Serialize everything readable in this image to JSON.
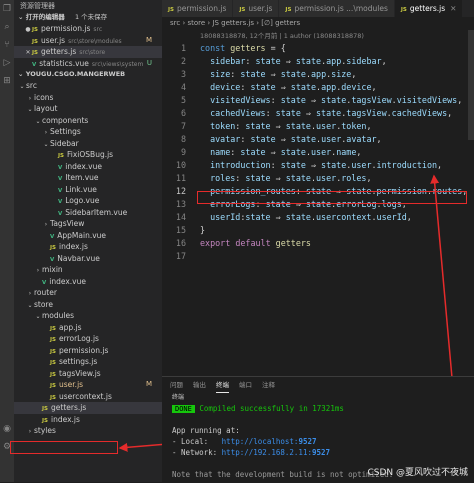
{
  "activity_bar": {
    "icons": [
      "files-icon",
      "search-icon",
      "source-control-icon",
      "run-debug-icon",
      "extensions-icon",
      "account-icon",
      "settings-icon"
    ]
  },
  "sidebar": {
    "title": "资源管理器",
    "open_editors": {
      "header": "打开的编辑器",
      "unsaved": "1 个未保存",
      "items": [
        {
          "name": "permission.js",
          "path": "src",
          "type": "js",
          "badge": "",
          "dot": true
        },
        {
          "name": "user.js",
          "path": "src\\store\\modules",
          "type": "js",
          "badge": "M",
          "dot": false
        },
        {
          "name": "getters.js",
          "path": "src\\store",
          "type": "js",
          "badge": "",
          "dot": false,
          "close": true
        },
        {
          "name": "statistics.vue",
          "path": "src\\views\\system",
          "type": "vue",
          "badge": "U",
          "dot": false
        }
      ]
    },
    "workspace": {
      "header": "YOUGU.CSGO.MANGERWEB",
      "tree": [
        {
          "label": "src",
          "depth": 0,
          "kind": "folder",
          "open": true
        },
        {
          "label": "icons",
          "depth": 1,
          "kind": "folder",
          "open": false
        },
        {
          "label": "layout",
          "depth": 1,
          "kind": "folder",
          "open": true
        },
        {
          "label": "components",
          "depth": 2,
          "kind": "folder",
          "open": true
        },
        {
          "label": "Settings",
          "depth": 3,
          "kind": "folder",
          "open": false
        },
        {
          "label": "Sidebar",
          "depth": 3,
          "kind": "folder",
          "open": true
        },
        {
          "label": "FixiOSBug.js",
          "depth": 4,
          "kind": "js"
        },
        {
          "label": "index.vue",
          "depth": 4,
          "kind": "vue"
        },
        {
          "label": "Item.vue",
          "depth": 4,
          "kind": "vue"
        },
        {
          "label": "Link.vue",
          "depth": 4,
          "kind": "vue"
        },
        {
          "label": "Logo.vue",
          "depth": 4,
          "kind": "vue"
        },
        {
          "label": "SidebarItem.vue",
          "depth": 4,
          "kind": "vue"
        },
        {
          "label": "TagsView",
          "depth": 3,
          "kind": "folder",
          "open": false
        },
        {
          "label": "AppMain.vue",
          "depth": 3,
          "kind": "vue"
        },
        {
          "label": "index.js",
          "depth": 3,
          "kind": "js"
        },
        {
          "label": "Navbar.vue",
          "depth": 3,
          "kind": "vue"
        },
        {
          "label": "mixin",
          "depth": 2,
          "kind": "folder",
          "open": false
        },
        {
          "label": "index.vue",
          "depth": 2,
          "kind": "vue"
        },
        {
          "label": "router",
          "depth": 1,
          "kind": "folder",
          "open": false
        },
        {
          "label": "store",
          "depth": 1,
          "kind": "folder",
          "open": true
        },
        {
          "label": "modules",
          "depth": 2,
          "kind": "folder",
          "open": true
        },
        {
          "label": "app.js",
          "depth": 3,
          "kind": "js"
        },
        {
          "label": "errorLog.js",
          "depth": 3,
          "kind": "js"
        },
        {
          "label": "permission.js",
          "depth": 3,
          "kind": "js"
        },
        {
          "label": "settings.js",
          "depth": 3,
          "kind": "js"
        },
        {
          "label": "tagsView.js",
          "depth": 3,
          "kind": "js"
        },
        {
          "label": "user.js",
          "depth": 3,
          "kind": "js",
          "badge": "M"
        },
        {
          "label": "usercontext.js",
          "depth": 3,
          "kind": "js"
        },
        {
          "label": "getters.js",
          "depth": 2,
          "kind": "js",
          "selected": true
        },
        {
          "label": "index.js",
          "depth": 2,
          "kind": "js"
        },
        {
          "label": "styles",
          "depth": 1,
          "kind": "folder",
          "open": false
        }
      ]
    }
  },
  "tabs": [
    {
      "name": "permission.js",
      "extra": "",
      "active": false
    },
    {
      "name": "user.js",
      "extra": "",
      "active": false
    },
    {
      "name": "permission.js",
      "extra": "...\\modules",
      "active": false
    },
    {
      "name": "getters.js",
      "extra": "",
      "active": true
    }
  ],
  "breadcrumb": "src › store › JS getters.js › [∅] getters",
  "editor": {
    "blame": "18088318878, 12个月前 | 1 author (18088318878)",
    "lines": [
      {
        "n": "1",
        "tokens": [
          [
            "kw",
            "const"
          ],
          [
            "pu",
            " "
          ],
          [
            "fn",
            "getters"
          ],
          [
            "op",
            " = "
          ],
          [
            "pu",
            "{"
          ]
        ]
      },
      {
        "n": "2",
        "tokens": [
          [
            "pr",
            "  sidebar"
          ],
          [
            "pu",
            ": "
          ],
          [
            "pr",
            "state"
          ],
          [
            "op",
            " ⇒ "
          ],
          [
            "pr",
            "state"
          ],
          [
            "pu",
            "."
          ],
          [
            "pr",
            "app"
          ],
          [
            "pu",
            "."
          ],
          [
            "pr",
            "sidebar"
          ],
          [
            "pu",
            ","
          ]
        ]
      },
      {
        "n": "3",
        "tokens": [
          [
            "pr",
            "  size"
          ],
          [
            "pu",
            ": "
          ],
          [
            "pr",
            "state"
          ],
          [
            "op",
            " ⇒ "
          ],
          [
            "pr",
            "state"
          ],
          [
            "pu",
            "."
          ],
          [
            "pr",
            "app"
          ],
          [
            "pu",
            "."
          ],
          [
            "pr",
            "size"
          ],
          [
            "pu",
            ","
          ]
        ]
      },
      {
        "n": "4",
        "tokens": [
          [
            "pr",
            "  device"
          ],
          [
            "pu",
            ": "
          ],
          [
            "pr",
            "state"
          ],
          [
            "op",
            " ⇒ "
          ],
          [
            "pr",
            "state"
          ],
          [
            "pu",
            "."
          ],
          [
            "pr",
            "app"
          ],
          [
            "pu",
            "."
          ],
          [
            "pr",
            "device"
          ],
          [
            "pu",
            ","
          ]
        ]
      },
      {
        "n": "5",
        "tokens": [
          [
            "pr",
            "  visitedViews"
          ],
          [
            "pu",
            ": "
          ],
          [
            "pr",
            "state"
          ],
          [
            "op",
            " ⇒ "
          ],
          [
            "pr",
            "state"
          ],
          [
            "pu",
            "."
          ],
          [
            "pr",
            "tagsView"
          ],
          [
            "pu",
            "."
          ],
          [
            "pr",
            "visitedViews"
          ],
          [
            "pu",
            ","
          ]
        ]
      },
      {
        "n": "6",
        "tokens": [
          [
            "pr",
            "  cachedViews"
          ],
          [
            "pu",
            ": "
          ],
          [
            "pr",
            "state"
          ],
          [
            "op",
            " ⇒ "
          ],
          [
            "pr",
            "state"
          ],
          [
            "pu",
            "."
          ],
          [
            "pr",
            "tagsView"
          ],
          [
            "pu",
            "."
          ],
          [
            "pr",
            "cachedViews"
          ],
          [
            "pu",
            ","
          ]
        ]
      },
      {
        "n": "7",
        "tokens": [
          [
            "pr",
            "  token"
          ],
          [
            "pu",
            ": "
          ],
          [
            "pr",
            "state"
          ],
          [
            "op",
            " ⇒ "
          ],
          [
            "pr",
            "state"
          ],
          [
            "pu",
            "."
          ],
          [
            "pr",
            "user"
          ],
          [
            "pu",
            "."
          ],
          [
            "pr",
            "token"
          ],
          [
            "pu",
            ","
          ]
        ]
      },
      {
        "n": "8",
        "tokens": [
          [
            "pr",
            "  avatar"
          ],
          [
            "pu",
            ": "
          ],
          [
            "pr",
            "state"
          ],
          [
            "op",
            " ⇒ "
          ],
          [
            "pr",
            "state"
          ],
          [
            "pu",
            "."
          ],
          [
            "pr",
            "user"
          ],
          [
            "pu",
            "."
          ],
          [
            "pr",
            "avatar"
          ],
          [
            "pu",
            ","
          ]
        ]
      },
      {
        "n": "9",
        "tokens": [
          [
            "pr",
            "  name"
          ],
          [
            "pu",
            ": "
          ],
          [
            "pr",
            "state"
          ],
          [
            "op",
            " ⇒ "
          ],
          [
            "pr",
            "state"
          ],
          [
            "pu",
            "."
          ],
          [
            "pr",
            "user"
          ],
          [
            "pu",
            "."
          ],
          [
            "pr",
            "name"
          ],
          [
            "pu",
            ","
          ]
        ]
      },
      {
        "n": "10",
        "tokens": [
          [
            "pr",
            "  introduction"
          ],
          [
            "pu",
            ": "
          ],
          [
            "pr",
            "state"
          ],
          [
            "op",
            " ⇒ "
          ],
          [
            "pr",
            "state"
          ],
          [
            "pu",
            "."
          ],
          [
            "pr",
            "user"
          ],
          [
            "pu",
            "."
          ],
          [
            "pr",
            "introduction"
          ],
          [
            "pu",
            ","
          ]
        ]
      },
      {
        "n": "11",
        "tokens": [
          [
            "pr",
            "  roles"
          ],
          [
            "pu",
            ": "
          ],
          [
            "pr",
            "state"
          ],
          [
            "op",
            " ⇒ "
          ],
          [
            "pr",
            "state"
          ],
          [
            "pu",
            "."
          ],
          [
            "pr",
            "user"
          ],
          [
            "pu",
            "."
          ],
          [
            "pr",
            "roles"
          ],
          [
            "pu",
            ","
          ]
        ]
      },
      {
        "n": "12",
        "tokens": [
          [
            "pr",
            "  permission_routes"
          ],
          [
            "pu",
            ": "
          ],
          [
            "pr",
            "state"
          ],
          [
            "op",
            " ⇒ "
          ],
          [
            "pr",
            "state"
          ],
          [
            "pu",
            "."
          ],
          [
            "pr",
            "permission"
          ],
          [
            "pu",
            "."
          ],
          [
            "pr",
            "routes"
          ],
          [
            "pu",
            ","
          ]
        ]
      },
      {
        "n": "13",
        "tokens": [
          [
            "pr",
            "  errorLogs"
          ],
          [
            "pu",
            ": "
          ],
          [
            "pr",
            "state"
          ],
          [
            "op",
            " ⇒ "
          ],
          [
            "pr",
            "state"
          ],
          [
            "pu",
            "."
          ],
          [
            "pr",
            "errorLog"
          ],
          [
            "pu",
            "."
          ],
          [
            "pr",
            "logs"
          ],
          [
            "pu",
            ","
          ]
        ]
      },
      {
        "n": "14",
        "tokens": [
          [
            "pr",
            "  userId"
          ],
          [
            "pu",
            ":"
          ],
          [
            "pr",
            "state"
          ],
          [
            "op",
            " ⇒ "
          ],
          [
            "pr",
            "state"
          ],
          [
            "pu",
            "."
          ],
          [
            "pr",
            "usercontext"
          ],
          [
            "pu",
            "."
          ],
          [
            "pr",
            "userId"
          ],
          [
            "pu",
            ","
          ]
        ]
      },
      {
        "n": "15",
        "tokens": [
          [
            "pu",
            "}"
          ]
        ]
      },
      {
        "n": "16",
        "tokens": [
          [
            "kw2",
            "export"
          ],
          [
            "pu",
            " "
          ],
          [
            "kw2",
            "default"
          ],
          [
            "pu",
            " "
          ],
          [
            "fn",
            "getters"
          ]
        ]
      },
      {
        "n": "17",
        "tokens": []
      }
    ]
  },
  "panel": {
    "tabs": [
      "问题",
      "输出",
      "终端",
      "端口",
      "注释"
    ],
    "active_tab": "终端",
    "sub": "终端",
    "done_badge": "DONE",
    "compiled": " Compiled successfully in 17321ms",
    "running": "App running at:",
    "local_label": "- Local:   ",
    "local_url": "http://localhost:",
    "local_port": "9527",
    "network_label": "- Network: ",
    "network_url": "http://192.168.2.11:",
    "network_port": "9527",
    "note": "Note that the development build is not optimized."
  },
  "watermark": "CSDN @夏风吹过不夜城",
  "colors": {
    "highlight_box": "#e52b2b",
    "done_badge": "#16c60c"
  }
}
